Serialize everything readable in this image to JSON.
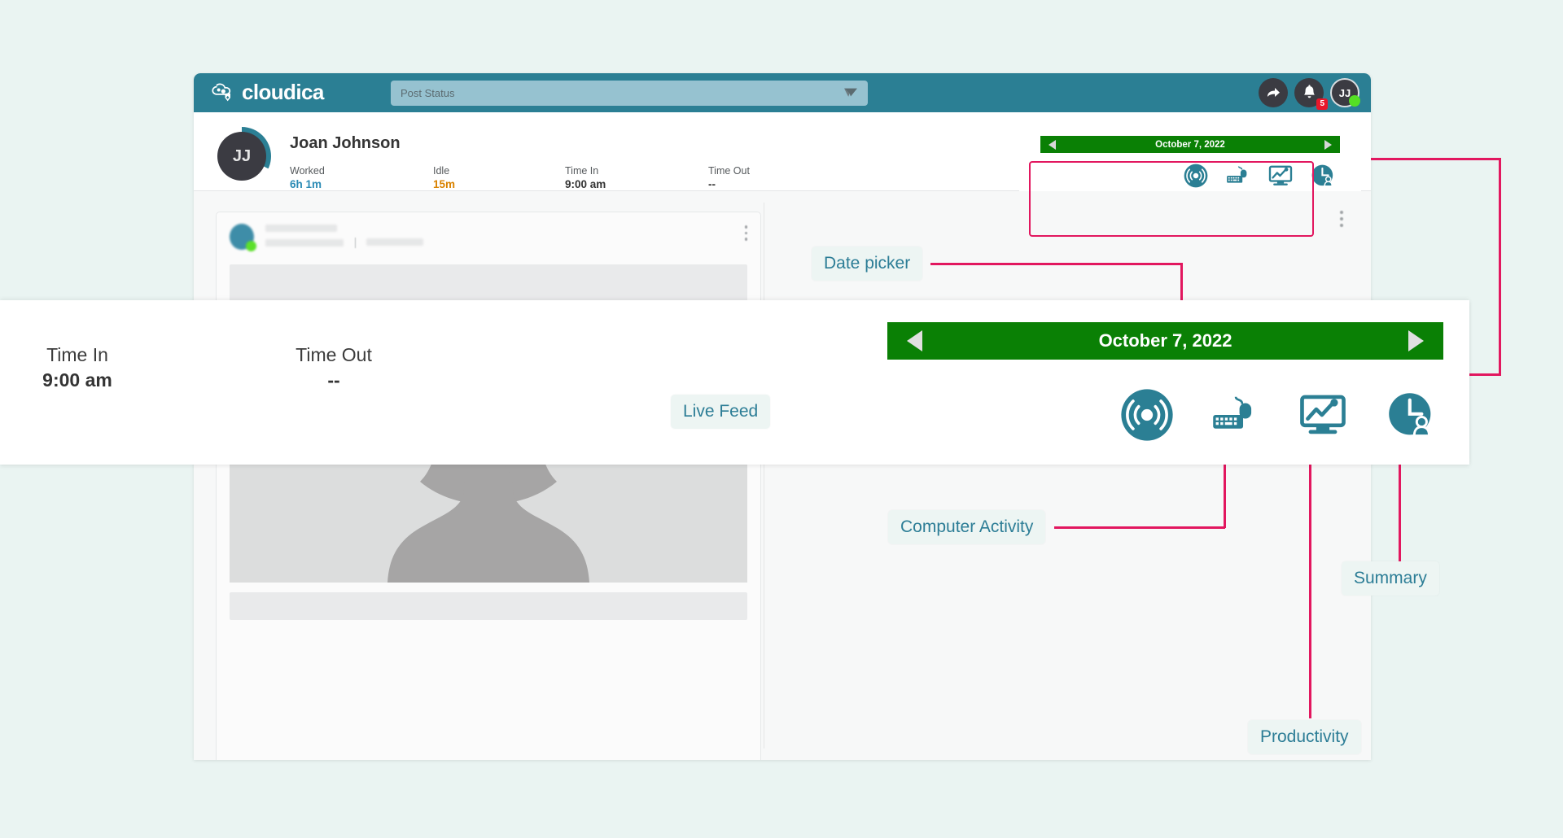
{
  "brand": {
    "name": "cloudica",
    "logo_icon": "cloud-logo-icon"
  },
  "topbar": {
    "post_status_placeholder": "Post Status",
    "send_icon": "paper-plane-icon",
    "share_icon": "share-arrow-icon",
    "notifications_icon": "bell-icon",
    "notifications_count": "5",
    "avatar_initials": "JJ"
  },
  "profile": {
    "avatar_initials": "JJ",
    "name": "Joan Johnson",
    "stats": [
      {
        "label": "Worked",
        "value": "6h 1m",
        "color": "#2b8bb5"
      },
      {
        "label": "Idle",
        "value": "15m",
        "color": "#d98200"
      },
      {
        "label": "Time In",
        "value": "9:00 am",
        "color": "#343434"
      },
      {
        "label": "Time Out",
        "value": "--",
        "color": "#343434"
      }
    ]
  },
  "tool_panel": {
    "date_label": "October 7, 2022",
    "prev_icon": "triangle-left-icon",
    "next_icon": "triangle-right-icon",
    "icons": [
      {
        "name": "live-feed-icon",
        "label": "Live Feed"
      },
      {
        "name": "computer-activity-icon",
        "label": "Computer Activity"
      },
      {
        "name": "productivity-icon",
        "label": "Productivity"
      },
      {
        "name": "summary-icon",
        "label": "Summary"
      }
    ]
  },
  "magnifier": {
    "time_in_label": "Time In",
    "time_in_value": "9:00 am",
    "time_out_label": "Time Out",
    "time_out_value": "--",
    "date_label": "October 7, 2022",
    "prev_icon": "triangle-left-icon",
    "next_icon": "triangle-right-icon"
  },
  "callouts": {
    "date_picker": "Date picker",
    "live_feed": "Live Feed",
    "computer_activity": "Computer Activity",
    "summary": "Summary",
    "productivity": "Productivity"
  },
  "colors": {
    "brand_teal": "#2b7f94",
    "date_green": "#0a8005",
    "callout_pink": "#e2175f",
    "callout_text": "#2c7d96",
    "page_bg": "#eaf4f2",
    "worked": "#2b8bb5",
    "idle": "#d98200",
    "badge_red": "#e8172b",
    "online_green": "#55e024"
  }
}
